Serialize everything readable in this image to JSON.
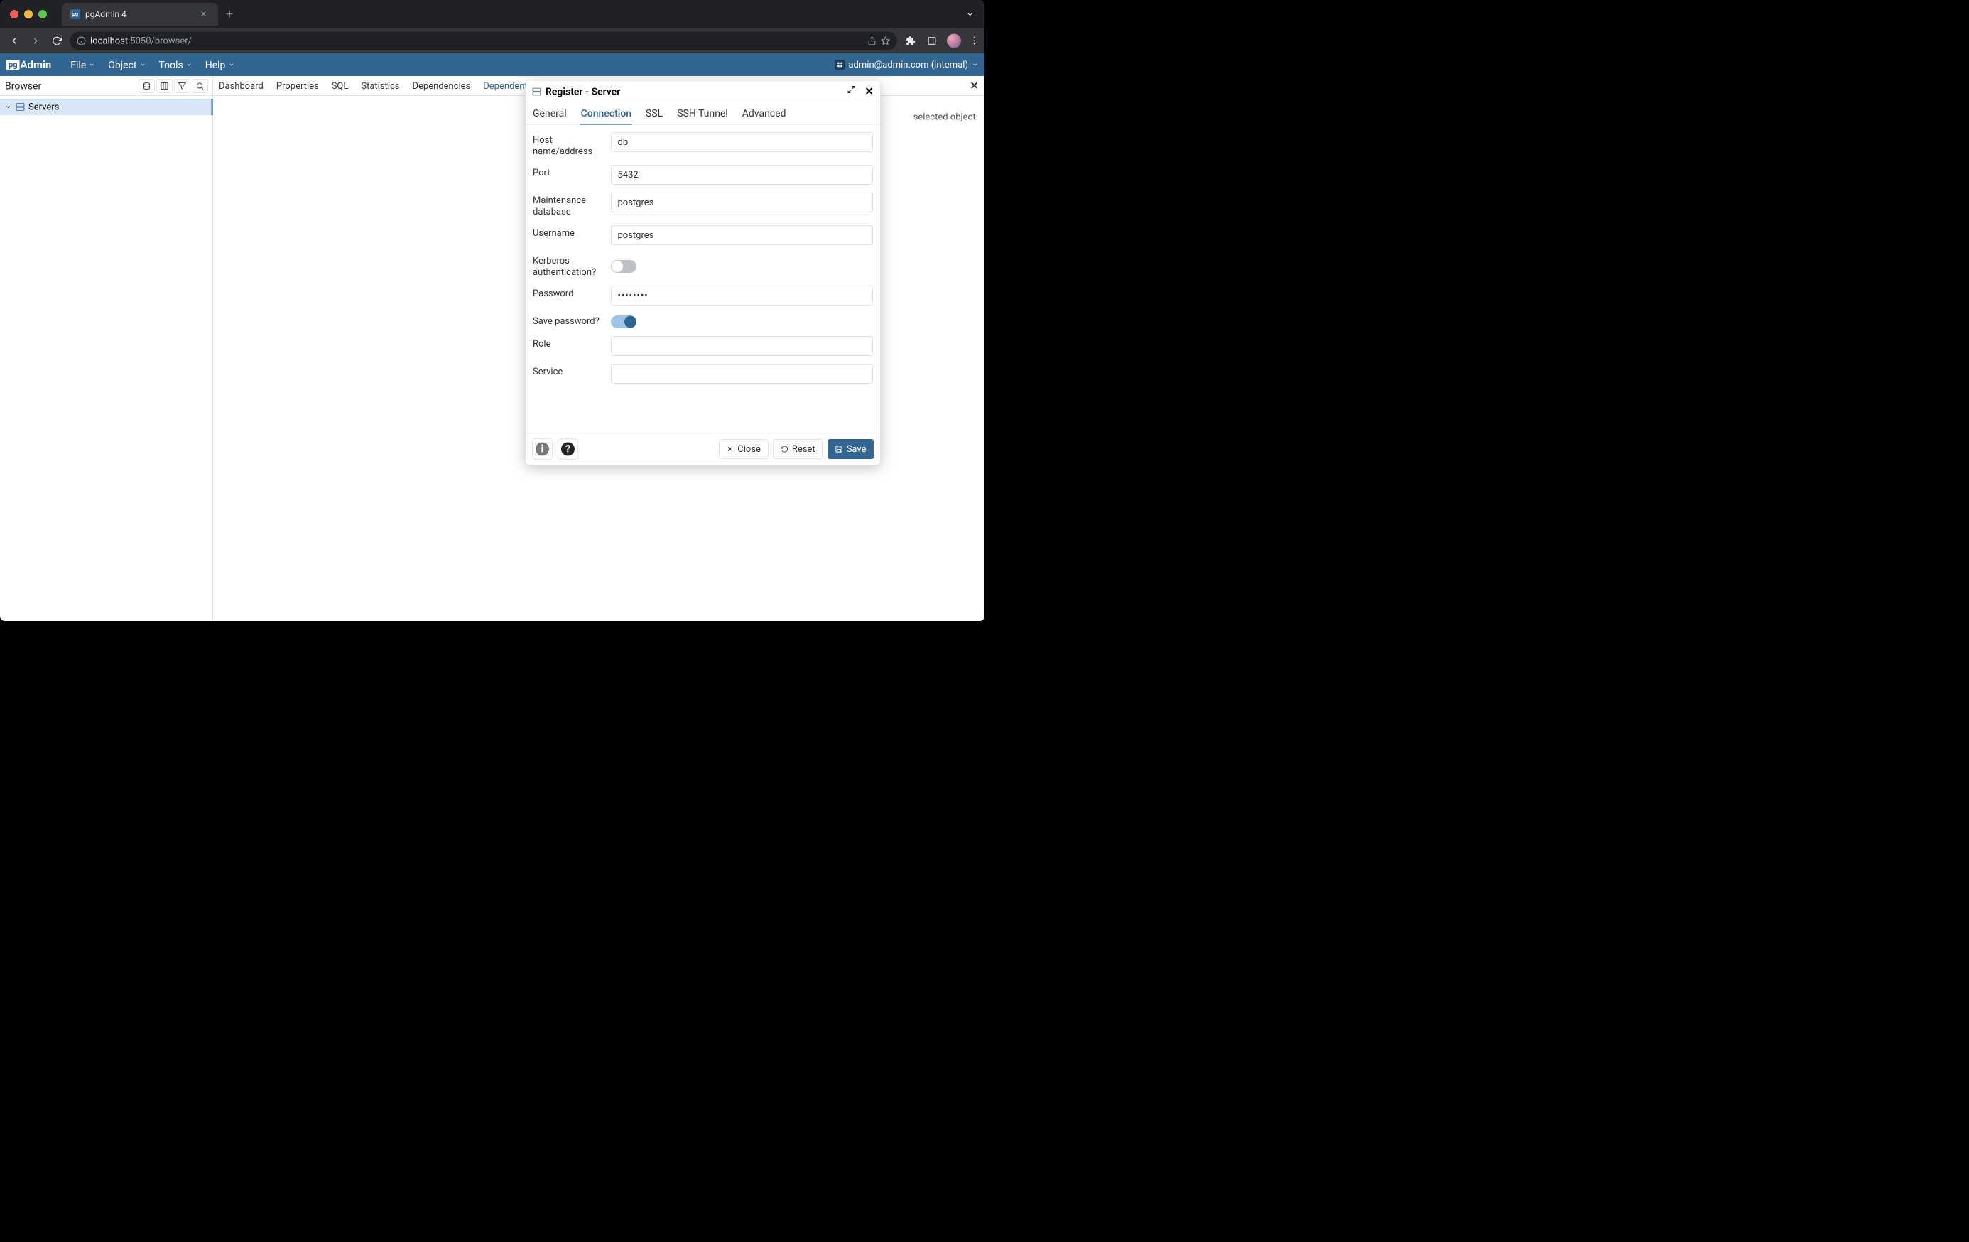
{
  "browser": {
    "tab_title": "pgAdmin 4",
    "url_host": "localhost",
    "url_path": ":5050/browser/"
  },
  "menubar": {
    "logo_prefix": "pg",
    "logo_text": "Admin",
    "items": [
      "File",
      "Object",
      "Tools",
      "Help"
    ],
    "user": "admin@admin.com (internal)"
  },
  "sidebar": {
    "title": "Browser",
    "tree_root": "Servers"
  },
  "tabs": [
    "Dashboard",
    "Properties",
    "SQL",
    "Statistics",
    "Dependencies",
    "Dependents"
  ],
  "active_tab": "Dependents",
  "main_message_tail": "selected object.",
  "dialog": {
    "title": "Register - Server",
    "tabs": [
      "General",
      "Connection",
      "SSL",
      "SSH Tunnel",
      "Advanced"
    ],
    "active_tab": "Connection",
    "form": {
      "host_label": "Host name/address",
      "host_value": "db",
      "port_label": "Port",
      "port_value": "5432",
      "maintdb_label": "Maintenance database",
      "maintdb_value": "postgres",
      "username_label": "Username",
      "username_value": "postgres",
      "kerberos_label": "Kerberos authentication?",
      "kerberos_on": false,
      "password_label": "Password",
      "password_value": "••••••••",
      "savepw_label": "Save password?",
      "savepw_on": true,
      "role_label": "Role",
      "role_value": "",
      "service_label": "Service",
      "service_value": ""
    },
    "buttons": {
      "close": "Close",
      "reset": "Reset",
      "save": "Save"
    }
  }
}
